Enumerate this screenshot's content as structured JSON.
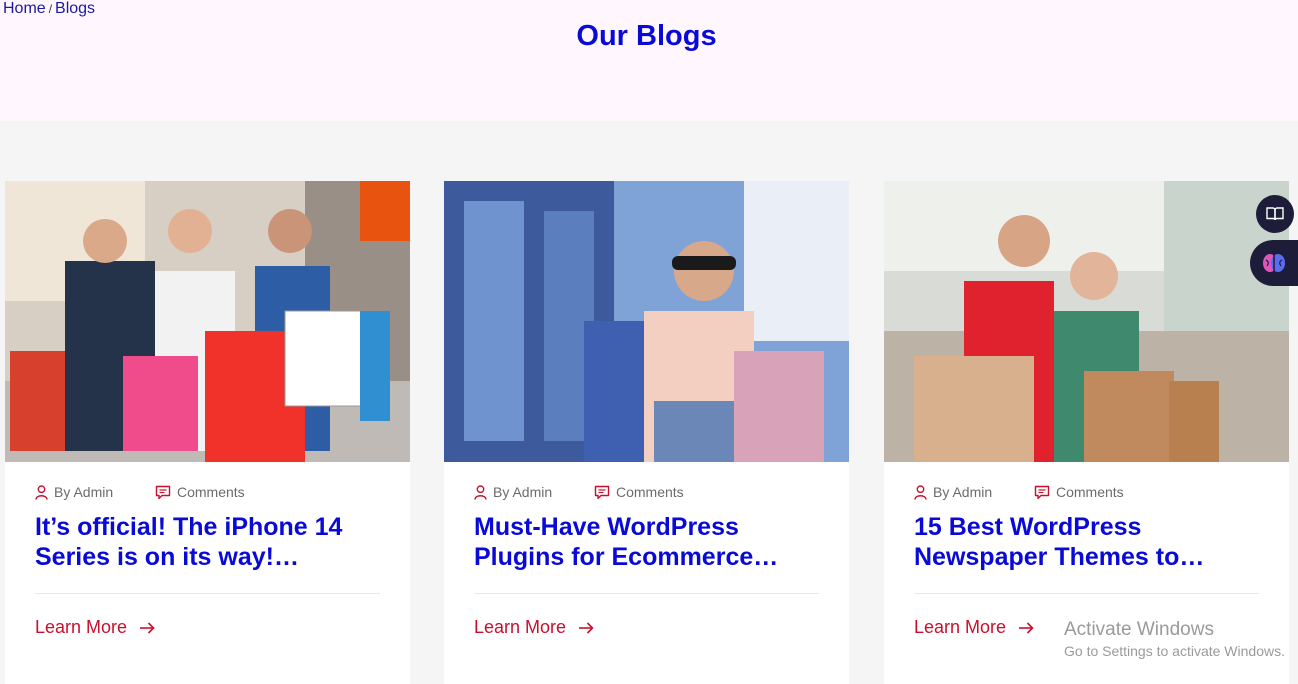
{
  "breadcrumb": {
    "home": "Home",
    "separator": "/",
    "current": "Blogs"
  },
  "page_title": "Our Blogs",
  "colors": {
    "title_blue": "#0a0ad6",
    "accent_red": "#c8102e",
    "hero_bg": "#fff7fd"
  },
  "posts": [
    {
      "author": "By Admin",
      "comments": "Comments",
      "title": "It’s official! The iPhone 14 Series is on its way!…",
      "cta": "Learn More",
      "image": "three-women-shopping-bags-photo"
    },
    {
      "author": "By Admin",
      "comments": "Comments",
      "title": "Must-Have WordPress Plugins for Ecommerce…",
      "cta": "Learn More",
      "image": "woman-sunglasses-shopping-bags-photo"
    },
    {
      "author": "By Admin",
      "comments": "Comments",
      "title": "15 Best WordPress Newspaper Themes to…",
      "cta": "Learn More",
      "image": "two-women-mall-shopping-photo"
    }
  ],
  "floating": {
    "reader_icon": "book-icon",
    "ai_icon": "brain-icon"
  },
  "watermark": {
    "line1": "Activate Windows",
    "line2": "Go to Settings to activate Windows."
  }
}
